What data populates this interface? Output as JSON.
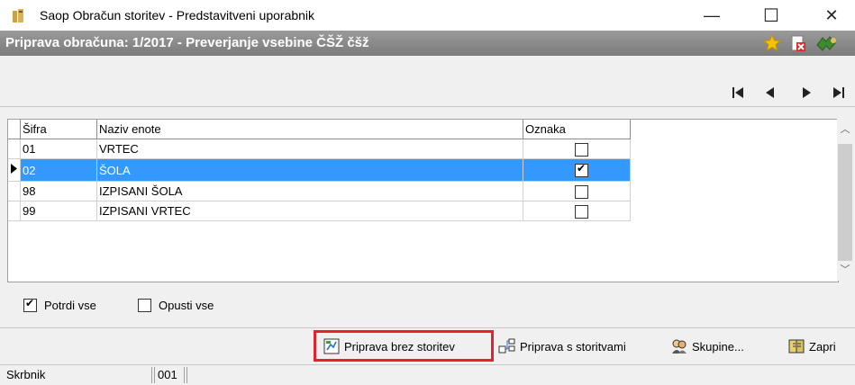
{
  "window": {
    "title": "Saop Obračun storitev - Predstavitveni uporabnik",
    "minimize": "—",
    "maximize": "☐",
    "close": "✕"
  },
  "header": {
    "title": "Priprava obračuna: 1/2017 - Preverjanje vsebine ČŠŽ čšž",
    "icons": [
      "star-icon",
      "delete-icon",
      "exit-icon"
    ]
  },
  "nav": {
    "buttons": [
      "first-icon",
      "prev-icon",
      "next-icon",
      "last-icon"
    ]
  },
  "grid": {
    "columns": [
      "Šifra",
      "Naziv enote",
      "Oznaka"
    ],
    "rows": [
      {
        "code": "01",
        "name": "VRTEC",
        "checked": false,
        "selected": false
      },
      {
        "code": "02",
        "name": "ŠOLA",
        "checked": true,
        "selected": true
      },
      {
        "code": "98",
        "name": "IZPISANI ŠOLA",
        "checked": false,
        "selected": false
      },
      {
        "code": "99",
        "name": "IZPISANI VRTEC",
        "checked": false,
        "selected": false
      }
    ]
  },
  "options": {
    "confirm_all": {
      "label": "Potrdi vse",
      "checked": true
    },
    "skip_all": {
      "label": "Opusti vse",
      "checked": false
    }
  },
  "toolbar": {
    "prepare_without": "Priprava brez storitev",
    "prepare_with": "Priprava s storitvami",
    "groups": "Skupine...",
    "close": "Zapri"
  },
  "status": {
    "label": "Skrbnik",
    "value": "001"
  },
  "colors": {
    "selection": "#3399ff",
    "highlight": "#e0232e",
    "header_bar": "#8a8a8a"
  }
}
